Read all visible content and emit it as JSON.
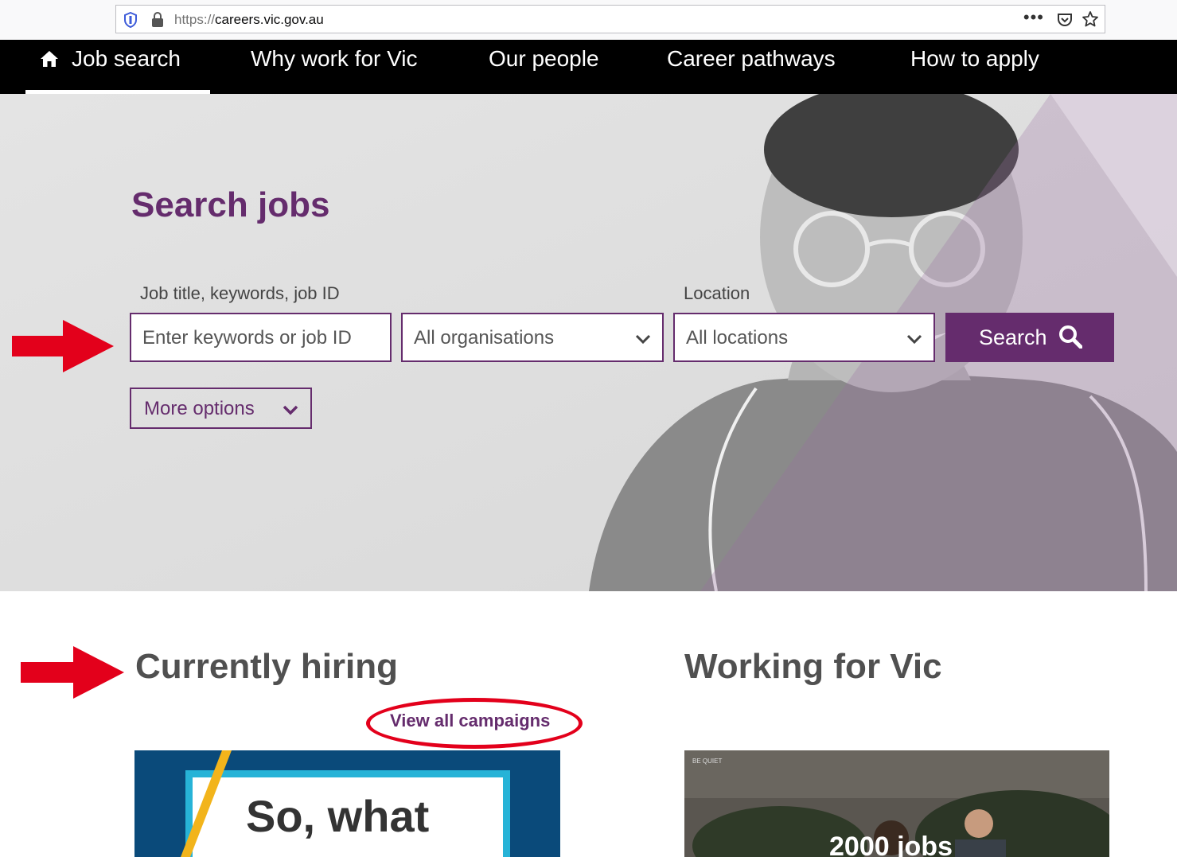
{
  "browser": {
    "url_scheme": "https://",
    "url_host": "careers.vic.gov.au",
    "more_label": "•••"
  },
  "nav": {
    "items": [
      {
        "label": "Job search",
        "active": true
      },
      {
        "label": "Why work for Vic"
      },
      {
        "label": "Our people"
      },
      {
        "label": "Career pathways"
      },
      {
        "label": "How to apply"
      }
    ]
  },
  "hero": {
    "title": "Search jobs",
    "keywords_label": "Job title, keywords, job ID",
    "keywords_placeholder": "Enter keywords or job ID",
    "organisation_select": "All organisations",
    "location_label": "Location",
    "location_select": "All locations",
    "search_label": "Search",
    "more_options_label": "More options"
  },
  "hiring": {
    "title": "Currently hiring",
    "view_all": "View all campaigns",
    "card_text": "So, what"
  },
  "working": {
    "title": "Working for Vic",
    "sign_text": "BE QUIET",
    "card_text": "2000 jobs"
  },
  "colors": {
    "brand_purple": "#652c6d",
    "annotation_red": "#e3001b",
    "nav_bg": "#000000"
  }
}
